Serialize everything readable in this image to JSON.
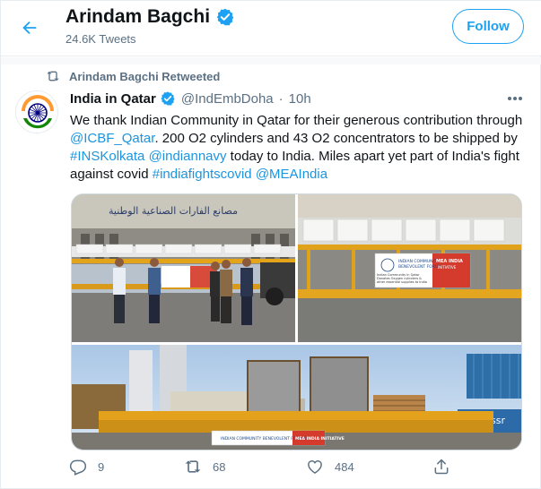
{
  "header": {
    "title": "Arindam Bagchi",
    "tweet_count": "24.6K Tweets",
    "follow_label": "Follow"
  },
  "retweet": {
    "label": "Arindam Bagchi Retweeted"
  },
  "tweet": {
    "author_name": "India in Qatar",
    "author_handle": "@IndEmbDoha",
    "separator": "·",
    "time": "10h",
    "segments": [
      {
        "text": "We thank Indian Community in Qatar for their generous contribution through ",
        "link": false
      },
      {
        "text": "@ICBF_Qatar",
        "link": true
      },
      {
        "text": ". 200 O2 cylinders and 43 O2 concentrators to be shipped by ",
        "link": false
      },
      {
        "text": "#INSKolkata",
        "link": true
      },
      {
        "text": " ",
        "link": false
      },
      {
        "text": "@indiannavy",
        "link": true
      },
      {
        "text": " today to India. Miles apart yet part of India's fight against covid ",
        "link": false
      },
      {
        "text": "#indiafightscovid",
        "link": true
      },
      {
        "text": " ",
        "link": false
      },
      {
        "text": "@MEAIndia",
        "link": true
      }
    ],
    "replies": "9",
    "retweets": "68",
    "likes": "484"
  },
  "media": {
    "photo1_sign": "مصانع الفارات الصناعية الوطنية",
    "banner_left_line1": "INDIAN COMMUNITY",
    "banner_left_line2": "BENEVOLENT FORUM",
    "banner_right_line1": "MEA INDIA",
    "banner_right_line2": "INITIATIVE",
    "banner_sub": "Indian Community in Qatar Donates Oxygen cylinders & other essential supplies to India",
    "photo3_banner_left": "INDIAN COMMUNITY BENEVOLENT FORUM",
    "photo3_banner_right": "MEA INDIA INITIATIVE",
    "photo3_side_text": "rossr"
  },
  "colors": {
    "accent": "#1da1f2",
    "verified": "#1da1f2",
    "muted": "#5b7083",
    "link": "#1b95e0"
  },
  "icons": {
    "back": "arrow-left-icon",
    "verified": "verified-badge-icon",
    "retweet": "retweet-icon",
    "more": "more-dots-icon",
    "reply": "reply-icon",
    "like": "heart-icon",
    "share": "share-icon"
  }
}
